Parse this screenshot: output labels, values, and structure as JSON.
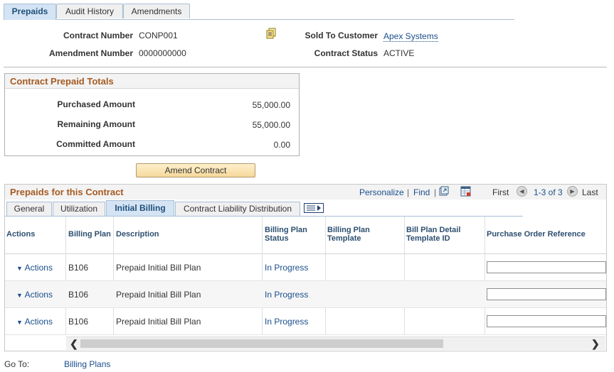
{
  "tabs": [
    {
      "label": "Prepaids",
      "active": true
    },
    {
      "label": "Audit History",
      "active": false
    },
    {
      "label": "Amendments",
      "active": false
    }
  ],
  "header": {
    "contract_number_label": "Contract Number",
    "contract_number": "CONP001",
    "amendment_number_label": "Amendment Number",
    "amendment_number": "0000000000",
    "sold_to_label": "Sold To Customer",
    "sold_to": "Apex Systems",
    "status_label": "Contract Status",
    "status": "ACTIVE",
    "notes_icon": "notes-icon"
  },
  "totals": {
    "title": "Contract Prepaid Totals",
    "rows": [
      {
        "label": "Purchased Amount",
        "value": "55,000.00"
      },
      {
        "label": "Remaining Amount",
        "value": "55,000.00"
      },
      {
        "label": "Committed Amount",
        "value": "0.00"
      }
    ]
  },
  "amend_button": "Amend Contract",
  "grid": {
    "title": "Prepaids for this Contract",
    "personalize": "Personalize",
    "find": "Find",
    "separator": "|",
    "first": "First",
    "range": "1-3 of 3",
    "last": "Last",
    "subtabs": [
      {
        "label": "General",
        "active": false
      },
      {
        "label": "Utilization",
        "active": false
      },
      {
        "label": "Initial Billing",
        "active": true
      },
      {
        "label": "Contract Liability Distribution",
        "active": false
      }
    ],
    "columns": {
      "actions": "Actions",
      "billing_plan": "Billing Plan",
      "description": "Description",
      "status_l1": "Billing Plan",
      "status_l2": "Status",
      "template_l1": "Billing Plan",
      "template_l2": "Template",
      "detail_l1": "Bill Plan Detail",
      "detail_l2": "Template ID",
      "po": "Purchase Order Reference"
    },
    "rows": [
      {
        "actions": "Actions",
        "plan": "B106",
        "description": "Prepaid Initial Bill Plan",
        "status": "In Progress",
        "template": "",
        "detail": "",
        "po": ""
      },
      {
        "actions": "Actions",
        "plan": "B106",
        "description": "Prepaid Initial Bill Plan",
        "status": "In Progress",
        "template": "",
        "detail": "",
        "po": ""
      },
      {
        "actions": "Actions",
        "plan": "B106",
        "description": "Prepaid Initial Bill Plan",
        "status": "In Progress",
        "template": "",
        "detail": "",
        "po": ""
      }
    ]
  },
  "goto": {
    "label": "Go To:",
    "link": "Billing Plans"
  },
  "colors": {
    "section_title": "#a55a22",
    "link": "#1a4f8c",
    "tab_active": "#d4e4f4"
  }
}
